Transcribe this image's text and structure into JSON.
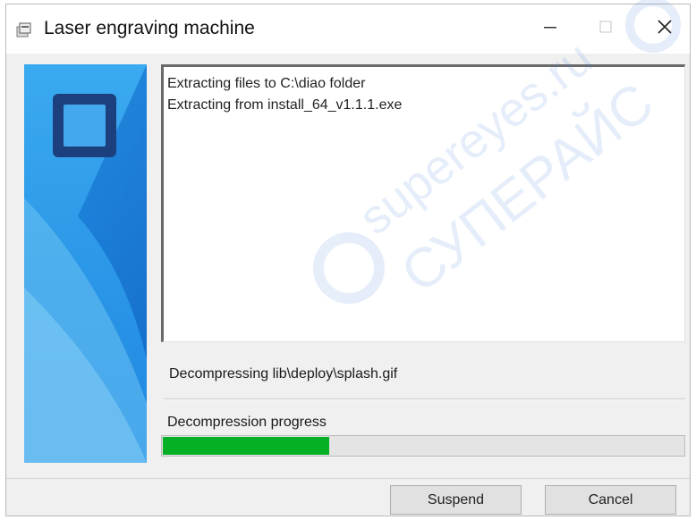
{
  "window": {
    "title": "Laser engraving machine",
    "icon": "installer-icon",
    "controls": [
      "minimize-icon",
      "maximize-icon",
      "close-icon"
    ]
  },
  "log": {
    "lines": [
      "Extracting files to C:\\diao folder",
      "Extracting from install_64_v1.1.1.exe"
    ]
  },
  "status_text": "Decompressing lib\\deploy\\splash.gif",
  "progress": {
    "label": "Decompression progress",
    "fraction": 0.32,
    "color": "#06b025"
  },
  "buttons": {
    "suspend": "Suspend",
    "cancel": "Cancel"
  },
  "watermark": {
    "latin": "supereyes.ru",
    "cyrillic": "СУПЕРАЙС"
  },
  "colors": {
    "banner_light": "#4fb4ee",
    "banner_dark": "#0a6fd0",
    "logo_frame": "#1c3f7e",
    "progress_fill": "#06b025"
  }
}
